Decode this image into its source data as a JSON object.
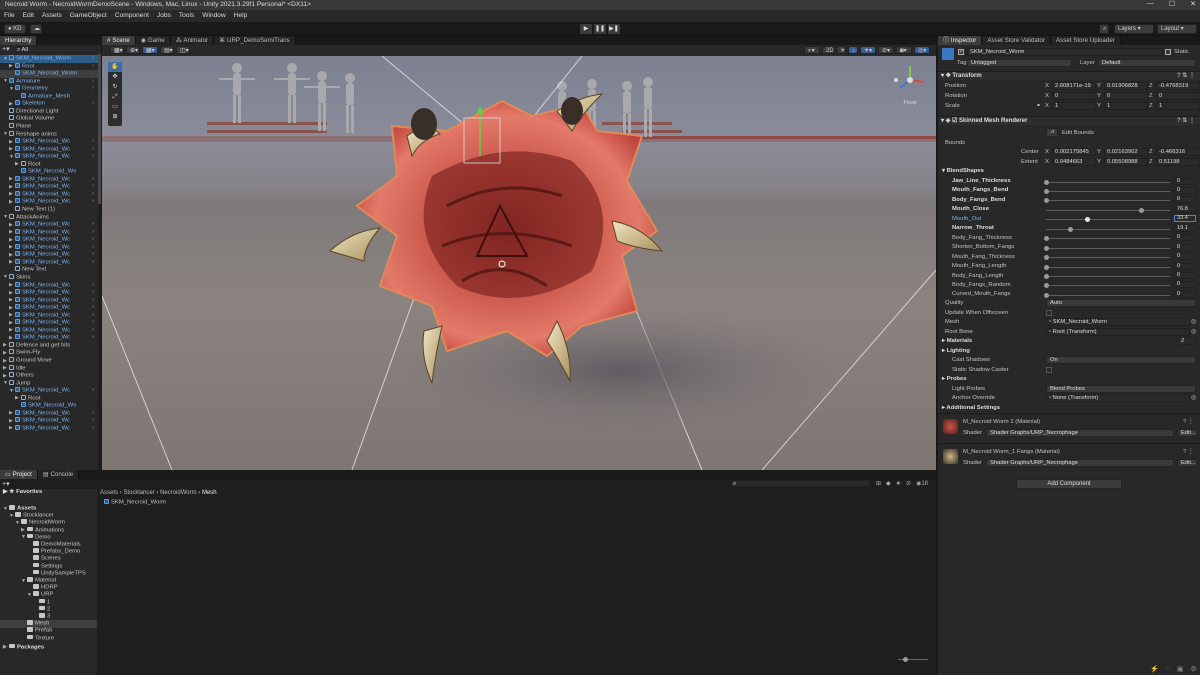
{
  "window": {
    "title": "Necroid Worm - NecroidWormDemoScene - Windows, Mac, Linux - Unity 2021.3.29f1 Personal* <DX11>",
    "controls": [
      "—",
      "☐",
      "✕"
    ]
  },
  "menu": [
    "File",
    "Edit",
    "Assets",
    "GameObject",
    "Component",
    "Jobs",
    "Tools",
    "Window",
    "Help"
  ],
  "toolbar": {
    "account": "KD",
    "layers": "Layers",
    "layout": "Layout"
  },
  "hierarchy": {
    "tab": "Hierarchy",
    "search": "All",
    "rows": [
      {
        "t": "SKM_Necroid_Worm",
        "d": 0,
        "k": "prefab",
        "a": "▼",
        "s": true
      },
      {
        "t": "Root",
        "d": 1,
        "k": "prefab",
        "a": "▶"
      },
      {
        "t": "SKM_Necroid_Worm",
        "d": 1,
        "k": "prefab",
        "a": "",
        "s2": true
      },
      {
        "t": "Armature",
        "d": 0,
        "k": "prefab",
        "a": "▼"
      },
      {
        "t": "Geometry",
        "d": 1,
        "k": "prefab",
        "a": "▼"
      },
      {
        "t": "Armature_Mesh",
        "d": 2,
        "k": "prefab",
        "a": ""
      },
      {
        "t": "Skeleton",
        "d": 1,
        "k": "prefab",
        "a": "▶"
      },
      {
        "t": "Directional Light",
        "d": 0,
        "k": "obj",
        "a": ""
      },
      {
        "t": "Global Volume",
        "d": 0,
        "k": "obj",
        "a": ""
      },
      {
        "t": "Plane",
        "d": 0,
        "k": "obj",
        "a": ""
      },
      {
        "t": "Reshape anims",
        "d": 0,
        "k": "obj",
        "a": "▼"
      },
      {
        "t": "SKM_Necroid_Wc",
        "d": 1,
        "k": "prefab",
        "a": "▶"
      },
      {
        "t": "SKM_Necroid_Wc",
        "d": 1,
        "k": "prefab",
        "a": "▶"
      },
      {
        "t": "SKM_Necroid_Wc",
        "d": 1,
        "k": "prefab",
        "a": "▼"
      },
      {
        "t": "Root",
        "d": 2,
        "k": "obj",
        "a": "▶"
      },
      {
        "t": "SKM_Necroid_Wo",
        "d": 2,
        "k": "prefab",
        "a": ""
      },
      {
        "t": "SKM_Necroid_Wc",
        "d": 1,
        "k": "prefab",
        "a": "▶"
      },
      {
        "t": "SKM_Necroid_Wc",
        "d": 1,
        "k": "prefab",
        "a": "▶"
      },
      {
        "t": "SKM_Necroid_Wc",
        "d": 1,
        "k": "prefab",
        "a": "▶"
      },
      {
        "t": "SKM_Necroid_Wc",
        "d": 1,
        "k": "prefab",
        "a": "▶"
      },
      {
        "t": "New Text (1)",
        "d": 1,
        "k": "obj",
        "a": ""
      },
      {
        "t": "AttackAnims",
        "d": 0,
        "k": "obj",
        "a": "▼"
      },
      {
        "t": "SKM_Necroid_Wc",
        "d": 1,
        "k": "prefab",
        "a": "▶"
      },
      {
        "t": "SKM_Necroid_Wc",
        "d": 1,
        "k": "prefab",
        "a": "▶"
      },
      {
        "t": "SKM_Necroid_Wc",
        "d": 1,
        "k": "prefab",
        "a": "▶"
      },
      {
        "t": "SKM_Necroid_Wc",
        "d": 1,
        "k": "prefab",
        "a": "▶"
      },
      {
        "t": "SKM_Necroid_Wc",
        "d": 1,
        "k": "prefab",
        "a": "▶"
      },
      {
        "t": "SKM_Necroid_Wc",
        "d": 1,
        "k": "prefab",
        "a": "▶"
      },
      {
        "t": "New Text",
        "d": 1,
        "k": "obj",
        "a": ""
      },
      {
        "t": "Skins",
        "d": 0,
        "k": "obj",
        "a": "▼"
      },
      {
        "t": "SKM_Necroid_Wc",
        "d": 1,
        "k": "prefab",
        "a": "▶"
      },
      {
        "t": "SKM_Necroid_Wc",
        "d": 1,
        "k": "prefab",
        "a": "▶"
      },
      {
        "t": "SKM_Necroid_Wc",
        "d": 1,
        "k": "prefab",
        "a": "▶"
      },
      {
        "t": "SKM_Necroid_Wc",
        "d": 1,
        "k": "prefab",
        "a": "▶"
      },
      {
        "t": "SKM_Necroid_Wc",
        "d": 1,
        "k": "prefab",
        "a": "▶"
      },
      {
        "t": "SKM_Necroid_Wc",
        "d": 1,
        "k": "prefab",
        "a": "▶"
      },
      {
        "t": "SKM_Necroid_Wc",
        "d": 1,
        "k": "prefab",
        "a": "▶"
      },
      {
        "t": "SKM_Necroid_Wc",
        "d": 1,
        "k": "prefab",
        "a": "▶"
      },
      {
        "t": "Defence and get hits",
        "d": 0,
        "k": "obj",
        "a": "▶"
      },
      {
        "t": "Swim-Fly",
        "d": 0,
        "k": "obj",
        "a": "▶"
      },
      {
        "t": "Ground Move",
        "d": 0,
        "k": "obj",
        "a": "▶"
      },
      {
        "t": "Idle",
        "d": 0,
        "k": "obj",
        "a": "▶"
      },
      {
        "t": "Others",
        "d": 0,
        "k": "obj",
        "a": "▶"
      },
      {
        "t": "Jump",
        "d": 0,
        "k": "obj",
        "a": "▼"
      },
      {
        "t": "SKM_Necroid_Wc",
        "d": 1,
        "k": "prefab",
        "a": "▼"
      },
      {
        "t": "Root",
        "d": 2,
        "k": "obj",
        "a": "▶"
      },
      {
        "t": "SKM_Necroid_Wo",
        "d": 2,
        "k": "prefab",
        "a": ""
      },
      {
        "t": "SKM_Necroid_Wc",
        "d": 1,
        "k": "prefab",
        "a": "▶"
      },
      {
        "t": "SKM_Necroid_Wc",
        "d": 1,
        "k": "prefab",
        "a": "▶"
      },
      {
        "t": "SKM_Necroid_Wc",
        "d": 1,
        "k": "prefab",
        "a": "▶"
      }
    ]
  },
  "scene": {
    "tabs": [
      "Scene",
      "Game",
      "Animator",
      "URP_DemoSemiTrans"
    ],
    "view_mode": "2D",
    "persp": "Persp"
  },
  "inspector": {
    "tabs": [
      "Inspector",
      "Asset Store Validator",
      "Asset Store Uploader"
    ],
    "object_name": "SKM_Necroid_Worm",
    "static_label": "Static",
    "tag_label": "Tag",
    "tag": "Untagged",
    "layer_label": "Layer",
    "layer": "Default",
    "transform": {
      "title": "Transform",
      "position": {
        "label": "Position",
        "x": "2.608171e-19",
        "y": "0.01906828",
        "z": "-0.4768319"
      },
      "rotation": {
        "label": "Rotation",
        "x": "0",
        "y": "0",
        "z": "0"
      },
      "scale": {
        "label": "Scale",
        "x": "1",
        "y": "1",
        "z": "1"
      }
    },
    "smr": {
      "title": "Skinned Mesh Renderer",
      "edit_bounds": "Edit Bounds",
      "bounds_label": "Bounds",
      "center": {
        "label": "Center",
        "x": "0.002175845",
        "y": "0.02163902",
        "z": "-0.466316"
      },
      "extent": {
        "label": "Extent",
        "x": "0.0484663",
        "y": "0.05508988",
        "z": "0.51198"
      },
      "blendshapes_label": "BlendShapes",
      "blendshapes": [
        {
          "name": "Jaw_Line_Thickness",
          "value": "0",
          "frac": 0,
          "bold": true
        },
        {
          "name": "Mouth_Fangs_Bend",
          "value": "0",
          "frac": 0,
          "bold": true
        },
        {
          "name": "Body_Fangs_Bend",
          "value": "0",
          "frac": 0,
          "bold": true
        },
        {
          "name": "Mouth_Close",
          "value": "76.8",
          "frac": 0.768,
          "bold": true
        },
        {
          "name": "Mouth_Out",
          "value": "33.4",
          "frac": 0.334,
          "bold": false,
          "active": true
        },
        {
          "name": "Narrow_Throat",
          "value": "19.1",
          "frac": 0.191,
          "bold": true
        },
        {
          "name": "Body_Fang_Thickness",
          "value": "0",
          "frac": 0
        },
        {
          "name": "Shorten_Bottom_Fangs",
          "value": "0",
          "frac": 0
        },
        {
          "name": "Mouth_Fang_Thickness",
          "value": "0",
          "frac": 0
        },
        {
          "name": "Mouth_Fang_Length",
          "value": "0",
          "frac": 0
        },
        {
          "name": "Body_Fang_Length",
          "value": "0",
          "frac": 0
        },
        {
          "name": "Body_Fangs_Random",
          "value": "0",
          "frac": 0
        },
        {
          "name": "Curved_Mouth_Fangs",
          "value": "0",
          "frac": 0
        }
      ],
      "quality": {
        "label": "Quality",
        "value": "Auto"
      },
      "update_offscreen": "Update When Offscreen",
      "mesh": {
        "label": "Mesh",
        "value": "SKM_Necroid_Worm"
      },
      "root_bone": {
        "label": "Root Bone",
        "value": "Root (Transform)"
      },
      "materials": {
        "label": "Materials",
        "value": "2"
      },
      "lighting": "Lighting",
      "cast_shadows": {
        "label": "Cast Shadows",
        "value": "On"
      },
      "static_caster": "Static Shadow Caster",
      "probes": "Probes",
      "light_probes": {
        "label": "Light Probes",
        "value": "Blend Probes"
      },
      "anchor": {
        "label": "Anchor Override",
        "value": "None (Transform)"
      },
      "additional": "Additional Settings"
    },
    "materials": [
      {
        "name": "M_Necroid Worm 1 (Material)",
        "shader_label": "Shader",
        "shader": "Shader Graphs/URP_Necrophage",
        "edit": "Edit..."
      },
      {
        "name": "M_Necroid Worm_1 Fangs (Material)",
        "shader_label": "Shader",
        "shader": "Shader Graphs/URP_Necrophage",
        "edit": "Edit..."
      }
    ],
    "add_component": "Add Component"
  },
  "project": {
    "tabs": [
      "Project",
      "Console"
    ],
    "favorites": "Favorites",
    "tree": [
      {
        "t": "Assets",
        "d": 0,
        "a": "▼",
        "b": true
      },
      {
        "t": "Stocklancer",
        "d": 1,
        "a": "▼"
      },
      {
        "t": "NecroidWorm",
        "d": 2,
        "a": "▼"
      },
      {
        "t": "Animations",
        "d": 3,
        "a": "▶"
      },
      {
        "t": "Demo",
        "d": 3,
        "a": "▼"
      },
      {
        "t": "DemoMaterials",
        "d": 4,
        "a": ""
      },
      {
        "t": "Prefabs_Demo",
        "d": 4,
        "a": ""
      },
      {
        "t": "Scenes",
        "d": 4,
        "a": ""
      },
      {
        "t": "Settings",
        "d": 4,
        "a": ""
      },
      {
        "t": "UnitySampleTPS",
        "d": 4,
        "a": ""
      },
      {
        "t": "Material",
        "d": 3,
        "a": "▼"
      },
      {
        "t": "HDRP",
        "d": 4,
        "a": ""
      },
      {
        "t": "URP",
        "d": 4,
        "a": "▼"
      },
      {
        "t": "1",
        "d": 5,
        "a": ""
      },
      {
        "t": "2",
        "d": 5,
        "a": ""
      },
      {
        "t": "3",
        "d": 5,
        "a": ""
      },
      {
        "t": "Mesh",
        "d": 3,
        "a": "",
        "sel": true
      },
      {
        "t": "Prefab",
        "d": 3,
        "a": ""
      },
      {
        "t": "Texture",
        "d": 3,
        "a": ""
      },
      {
        "t": "Packages",
        "d": 0,
        "a": "▶",
        "b": true
      }
    ],
    "breadcrumb": [
      "Assets",
      "Stocklancer",
      "NecroidWorm",
      "Mesh"
    ],
    "files": [
      "SKM_Necroid_Worm"
    ],
    "asset_count": "18"
  }
}
